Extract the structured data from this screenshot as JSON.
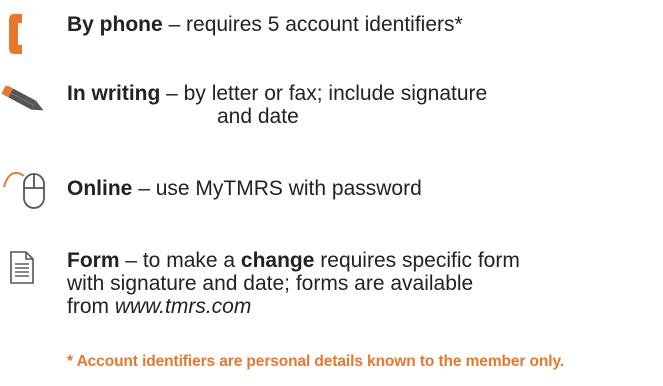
{
  "colors": {
    "accent": "#e8772e",
    "text": "#222222",
    "icon_gray": "#555555"
  },
  "items": [
    {
      "icon": "phone-icon",
      "title": "By phone",
      "description": "– requires 5 account identifiers*"
    },
    {
      "icon": "pencil-icon",
      "title": "In writing",
      "description": "– by letter or fax; include signature",
      "description_line2": "and date"
    },
    {
      "icon": "mouse-icon",
      "title": "Online",
      "description": "– use MyTMRS with password"
    },
    {
      "icon": "document-icon",
      "title": "Form",
      "desc_a": " – to make a ",
      "desc_b": "change",
      "desc_c": " requires specific form",
      "line2": "with signature and date; forms are available",
      "line3_prefix": "from ",
      "line3_link": "www.tmrs.com"
    }
  ],
  "footnote": "* Account identifiers are personal details known to the member only."
}
